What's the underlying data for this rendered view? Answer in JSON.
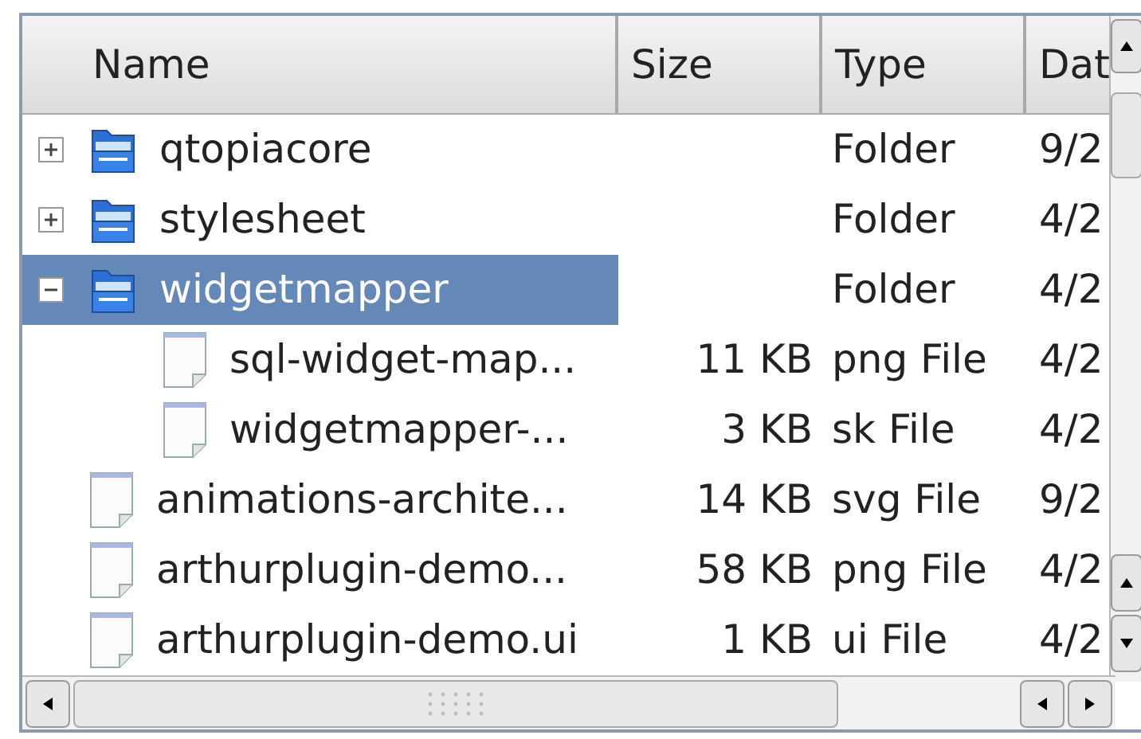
{
  "header": {
    "columns": [
      "Name",
      "Size",
      "Type",
      "Dat"
    ]
  },
  "tree": [
    {
      "kind": "folder",
      "name": "qtopiacore",
      "type": "Folder",
      "date": "9/2",
      "expanded": false,
      "selected": false
    },
    {
      "kind": "folder",
      "name": "stylesheet",
      "type": "Folder",
      "date": "4/2",
      "expanded": false,
      "selected": false
    },
    {
      "kind": "folder",
      "name": "widgetmapper",
      "type": "Folder",
      "date": "4/2",
      "expanded": true,
      "selected": true,
      "children": [
        {
          "kind": "file",
          "name": "sql-widget-map...",
          "size": "11 KB",
          "type": "png File",
          "date": "4/2",
          "selected": false
        },
        {
          "kind": "file",
          "name": "widgetmapper-...",
          "size": "3 KB",
          "type": "sk File",
          "date": "4/2",
          "selected": false
        }
      ]
    },
    {
      "kind": "file",
      "name": "animations-archite...",
      "size": "14 KB",
      "type": "svg File",
      "date": "9/2",
      "selected": false
    },
    {
      "kind": "file",
      "name": "arthurplugin-demo...",
      "size": "58 KB",
      "type": "png File",
      "date": "4/2",
      "selected": false
    },
    {
      "kind": "file",
      "name": "arthurplugin-demo.ui",
      "size": "1 KB",
      "type": "ui File",
      "date": "4/2",
      "selected": false
    }
  ]
}
